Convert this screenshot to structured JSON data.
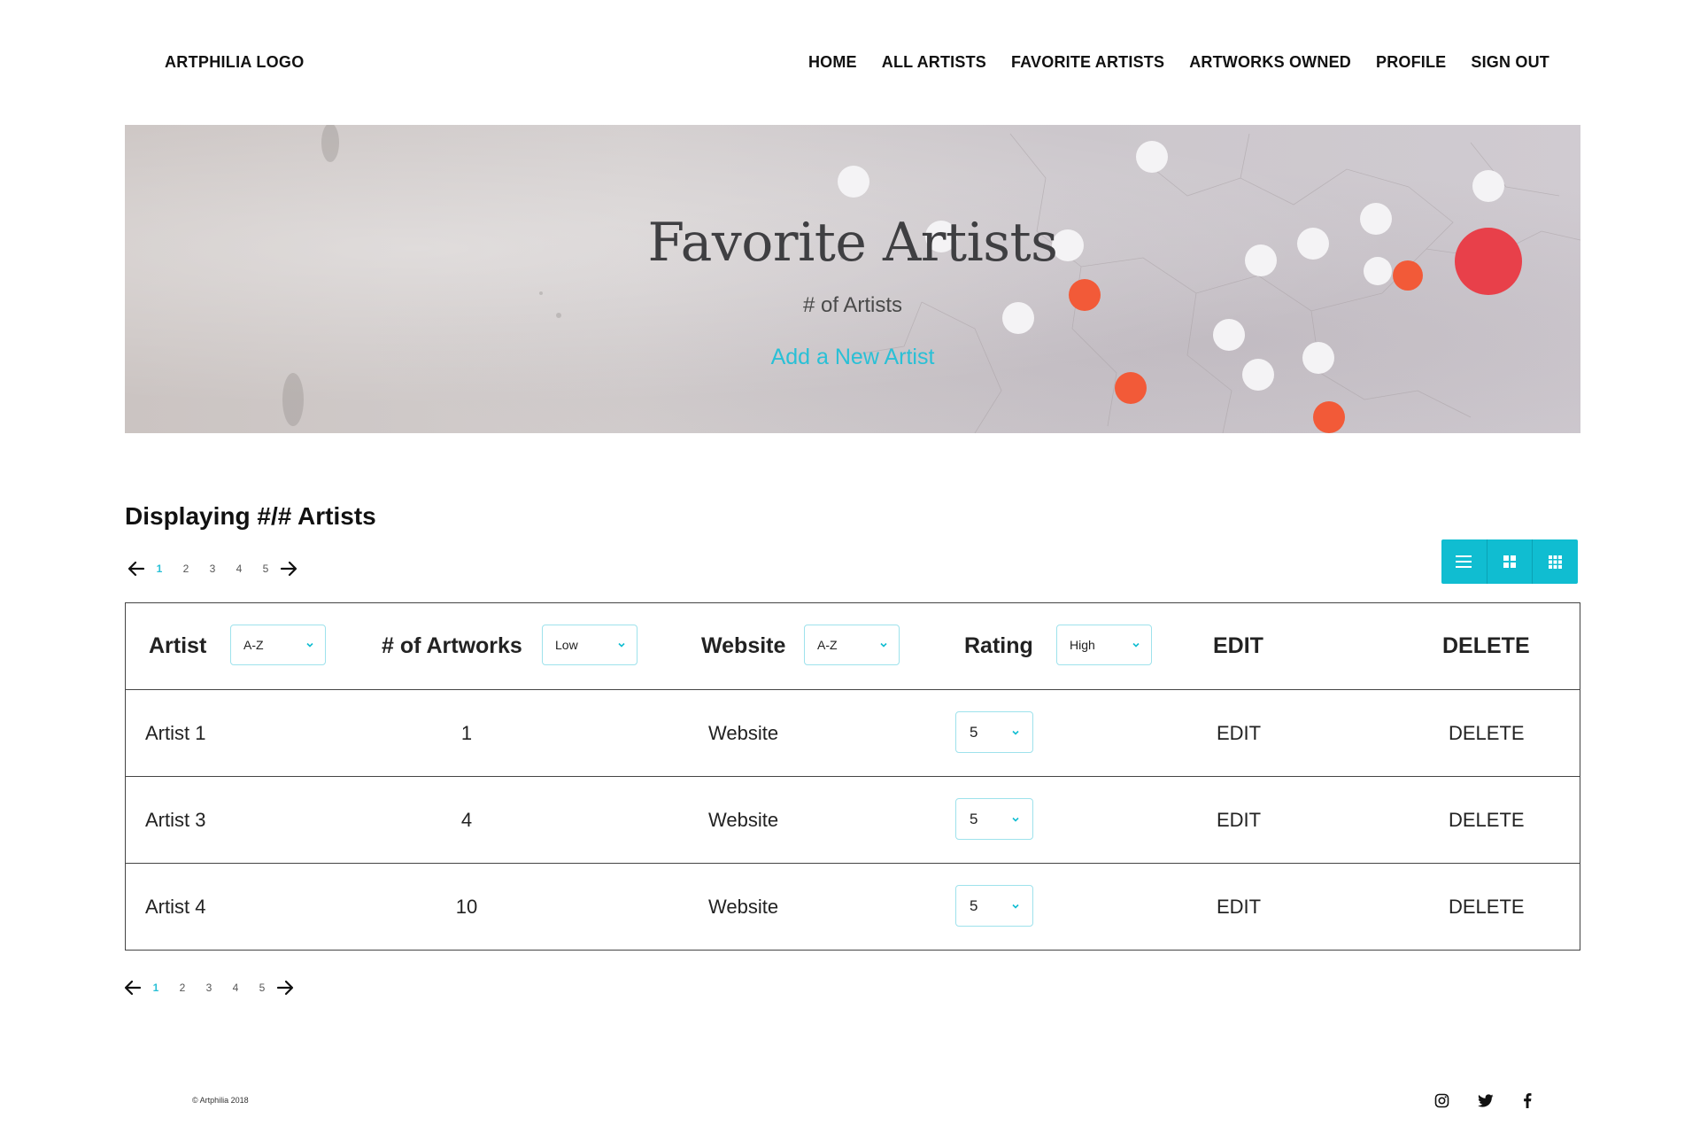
{
  "header": {
    "logo": "ARTPHILIA LOGO",
    "nav": [
      "HOME",
      "ALL ARTISTS",
      "FAVORITE ARTISTS",
      "ARTWORKS OWNED",
      "PROFILE",
      "SIGN OUT"
    ]
  },
  "hero": {
    "title": "Favorite Artists",
    "subtitle": "# of Artists",
    "add_link": "Add a New Artist"
  },
  "list": {
    "displaying": "Displaying #/# Artists",
    "pages": [
      "1",
      "2",
      "3",
      "4",
      "5"
    ],
    "active_page": "1",
    "view_modes": [
      "list-view-icon",
      "grid-view-icon",
      "compact-grid-view-icon"
    ]
  },
  "table": {
    "headers": {
      "artist": "Artist",
      "artist_sort": "A-Z",
      "artworks": "# of Artworks",
      "artworks_sort": "Low",
      "website": "Website",
      "website_sort": "A-Z",
      "rating": "Rating",
      "rating_sort": "High",
      "edit": "EDIT",
      "delete": "DELETE"
    },
    "rows": [
      {
        "artist": "Artist 1",
        "artworks": "1",
        "website": "Website",
        "rating": "5",
        "edit": "EDIT",
        "delete": "DELETE"
      },
      {
        "artist": "Artist 3",
        "artworks": "4",
        "website": "Website",
        "rating": "5",
        "edit": "EDIT",
        "delete": "DELETE"
      },
      {
        "artist": "Artist 4",
        "artworks": "10",
        "website": "Website",
        "rating": "5",
        "edit": "EDIT",
        "delete": "DELETE"
      }
    ]
  },
  "footer": {
    "copyright": "© Artphilia 2018",
    "social": [
      "instagram-icon",
      "twitter-icon",
      "facebook-icon"
    ]
  },
  "colors": {
    "accent": "#10bdd1",
    "link": "#29c0d6",
    "dot_red": "#e8404a",
    "dot_orange": "#f25a38"
  }
}
